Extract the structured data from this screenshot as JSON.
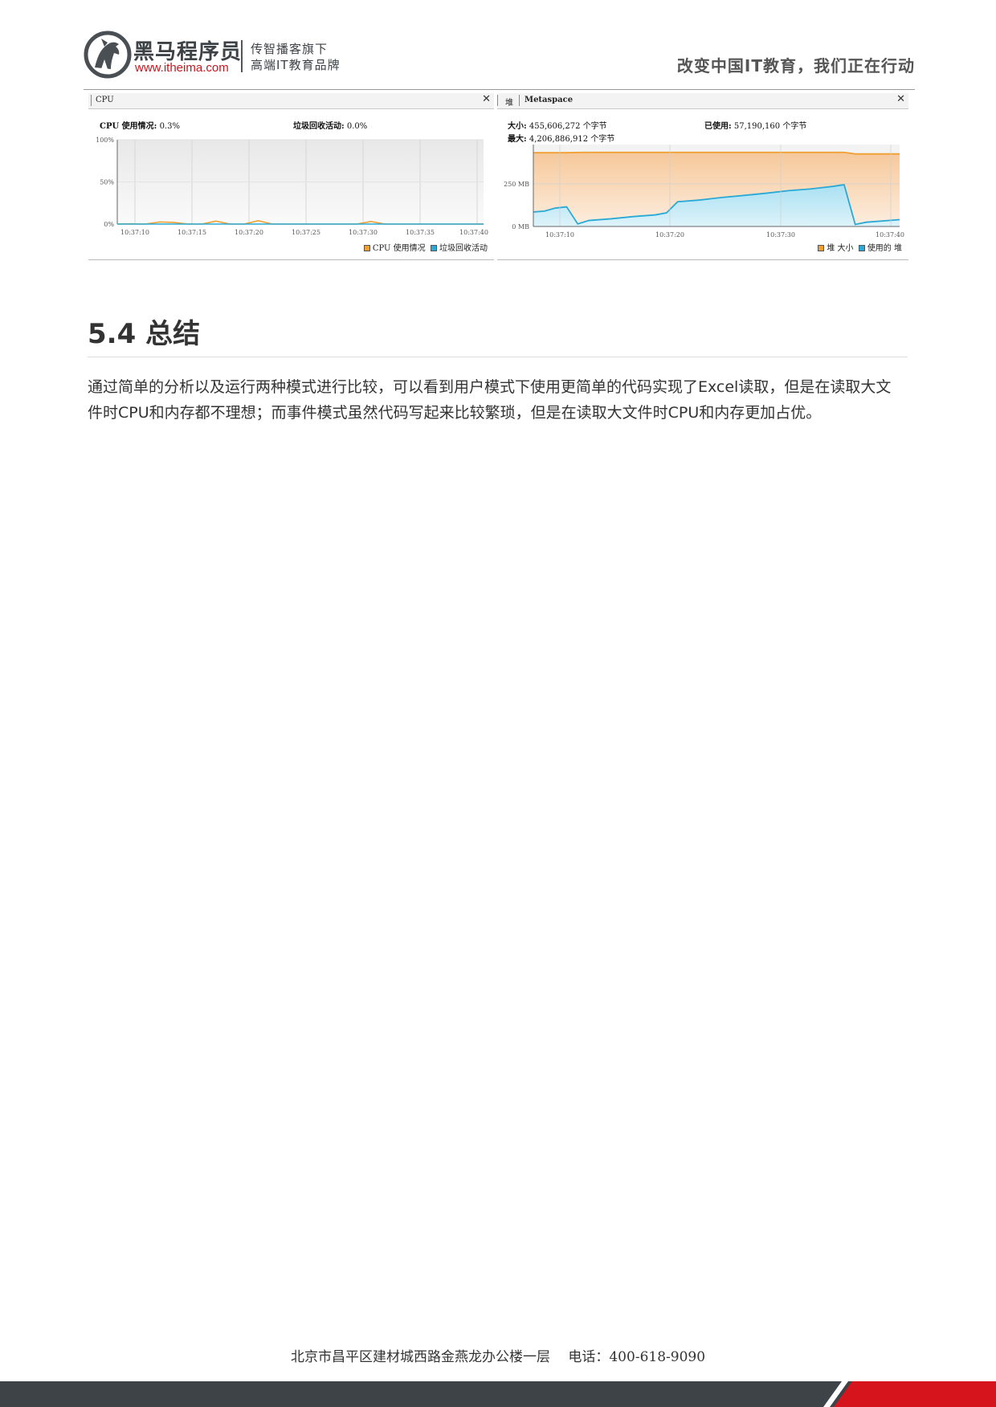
{
  "header": {
    "brand_cn": "黑马程序员",
    "brand_url": "www.itheima.com",
    "slogan_line1": "传智播客旗下",
    "slogan_line2": "高端IT教育品牌",
    "motto": "改变中国IT教育，我们正在行动"
  },
  "cpu_panel": {
    "tab_label": "CPU",
    "close_icon": "close-icon",
    "usage_label": "CPU 使用情况:",
    "usage_value": "0.3%",
    "gc_label": "垃圾回收活动:",
    "gc_value": "0.0%",
    "legend": [
      "CPU 使用情况",
      "垃圾回收活动"
    ]
  },
  "heap_panel": {
    "tab_label_1": "堆",
    "tab_label_2": "Metaspace",
    "close_icon": "close-icon",
    "size_label": "大小:",
    "size_value": "455,606,272 个字节",
    "used_label": "已使用:",
    "used_value": "57,190,160 个字节",
    "max_label": "最大:",
    "max_value": "4,206,886,912 个字节",
    "legend": [
      "堆 大小",
      "使用的 堆"
    ]
  },
  "colors": {
    "orange": "#f0a030",
    "blue": "#29a9d6",
    "footer_dark": "#3e4347",
    "footer_red": "#d5141c"
  },
  "chart_data": [
    {
      "type": "line",
      "title": "CPU",
      "x": [
        "10:37:10",
        "10:37:15",
        "10:37:20",
        "10:37:25",
        "10:37:30",
        "10:37:35",
        "10:37:40"
      ],
      "y_ticks": [
        "100%",
        "50%",
        "0%"
      ],
      "ylim": [
        0,
        100
      ],
      "grid": true,
      "legend_position": "bottom-right",
      "series": [
        {
          "name": "CPU 使用情况",
          "color": "#f0a030",
          "points": [
            [
              0,
              0
            ],
            [
              1,
              0.3
            ],
            [
              1.5,
              0
            ],
            [
              2,
              0
            ],
            [
              3,
              2.5
            ],
            [
              4,
              2
            ],
            [
              5,
              0
            ],
            [
              6,
              0
            ],
            [
              7,
              3.5
            ],
            [
              8,
              0
            ],
            [
              9,
              0
            ],
            [
              10,
              4
            ],
            [
              11,
              0
            ],
            [
              12,
              0
            ],
            [
              16,
              0
            ],
            [
              17,
              0
            ],
            [
              18,
              3
            ],
            [
              19,
              0
            ],
            [
              20,
              0
            ],
            [
              25,
              0
            ],
            [
              26,
              0
            ]
          ]
        },
        {
          "name": "垃圾回收活动",
          "color": "#29a9d6",
          "points": [
            [
              0,
              0
            ],
            [
              26,
              0
            ]
          ]
        }
      ]
    },
    {
      "type": "area",
      "title": "堆",
      "x": [
        "10:37:10",
        "10:37:20",
        "10:37:30",
        "10:37:40"
      ],
      "y_ticks": [
        "250 MB",
        "0 MB"
      ],
      "y_unit": "MB",
      "ylim": [
        0,
        480
      ],
      "grid": true,
      "legend_position": "bottom-right",
      "series": [
        {
          "name": "堆 大小",
          "color": "#f0a030",
          "points": [
            [
              0,
              432
            ],
            [
              3,
              432
            ],
            [
              4.5,
              434
            ],
            [
              28,
              434
            ],
            [
              29,
              425
            ],
            [
              33,
              425
            ]
          ]
        },
        {
          "name": "使用的 堆",
          "color": "#29a9d6",
          "points": [
            [
              0,
              85
            ],
            [
              1,
              90
            ],
            [
              2,
              108
            ],
            [
              3,
              115
            ],
            [
              4,
              15
            ],
            [
              5,
              35
            ],
            [
              7,
              45
            ],
            [
              9,
              58
            ],
            [
              11,
              68
            ],
            [
              12,
              80
            ],
            [
              13,
              145
            ],
            [
              15,
              155
            ],
            [
              17,
              170
            ],
            [
              19,
              182
            ],
            [
              21,
              195
            ],
            [
              23,
              210
            ],
            [
              25,
              220
            ],
            [
              27,
              235
            ],
            [
              28,
              245
            ],
            [
              29,
              12
            ],
            [
              30,
              25
            ],
            [
              33,
              40
            ]
          ]
        }
      ]
    }
  ],
  "section": {
    "title": "5.4 总结",
    "paragraph": "通过简单的分析以及运行两种模式进行比较，可以看到用户模式下使用更简单的代码实现了Excel读取，但是在读取大文件时CPU和内存都不理想；而事件模式虽然代码写起来比较繁琐，但是在读取大文件时CPU和内存更加占优。"
  },
  "footer": {
    "address": "北京市昌平区建材城西路金燕龙办公楼一层　 电话：400-618-9090"
  }
}
